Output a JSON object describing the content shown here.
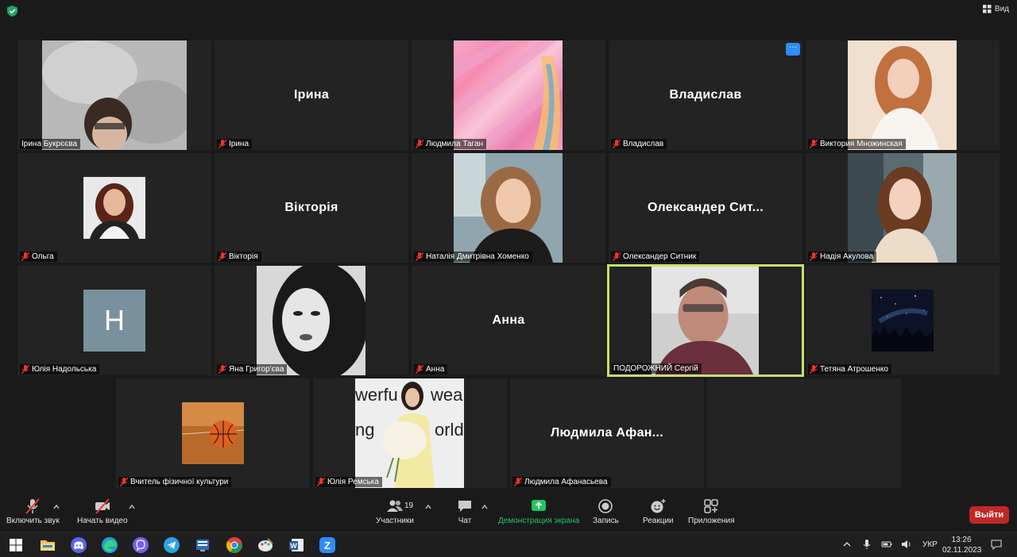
{
  "topbar": {
    "view_label": "Вид"
  },
  "tiles": [
    {
      "label": "Ірина Букрєєва",
      "center": "",
      "muted": false
    },
    {
      "label": "Ірина",
      "center": "Ірина",
      "muted": true
    },
    {
      "label": "Людмила Таган",
      "center": "",
      "muted": true
    },
    {
      "label": "Владислав",
      "center": "Владислав",
      "muted": true,
      "more": "···"
    },
    {
      "label": "Виктория Множинская",
      "center": "",
      "muted": true
    },
    {
      "label": "Ольга",
      "center": "",
      "muted": true
    },
    {
      "label": "Вікторія",
      "center": "Вікторія",
      "muted": true
    },
    {
      "label": "Наталія Дмитрівна Хоменко",
      "center": "",
      "muted": true
    },
    {
      "label": "Олександер Ситник",
      "center": "Олександер  Сит...",
      "muted": true
    },
    {
      "label": "Надія Акулова",
      "center": "",
      "muted": true
    },
    {
      "label": "Юлія Надольська",
      "center": "",
      "muted": true,
      "avatar_letter": "H"
    },
    {
      "label": "Яна Григор'єва",
      "center": "",
      "muted": true
    },
    {
      "label": "Анна",
      "center": "Анна",
      "muted": true
    },
    {
      "label": "ПОДОРОЖНИЙ Сергій",
      "center": "",
      "muted": false
    },
    {
      "label": "Тетяна Атрошенко",
      "center": "",
      "muted": true
    },
    {
      "label": "Вчитель фізичної культури",
      "center": "",
      "muted": true
    },
    {
      "label": "Юлія Ремська",
      "center": "",
      "muted": true
    },
    {
      "label": "Людмила Афанасьева",
      "center": "Людмила  Афан...",
      "muted": true
    }
  ],
  "toolbar": {
    "audio": "Включить звук",
    "video": "Начать видео",
    "participants": "Участники",
    "participants_count": "19",
    "chat": "Чат",
    "share": "Демонстрация экрана",
    "record": "Запись",
    "reactions": "Реакции",
    "apps": "Приложения",
    "leave": "Выйти"
  },
  "taskbar": {
    "apps": [
      "start-icon",
      "file-explorer-icon",
      "discord-icon",
      "edge-icon",
      "viber-icon",
      "telegram-icon",
      "app-icon",
      "chrome-icon",
      "paint-icon",
      "word-icon",
      "zoom-icon"
    ],
    "lang": "УКР",
    "time": "13:26",
    "date": "02.11.2023"
  },
  "colors": {
    "active_speaker_border": "#c6e06a",
    "leave": "#c22727",
    "share_green": "#22c55e",
    "accent_blue": "#2d8cff"
  }
}
